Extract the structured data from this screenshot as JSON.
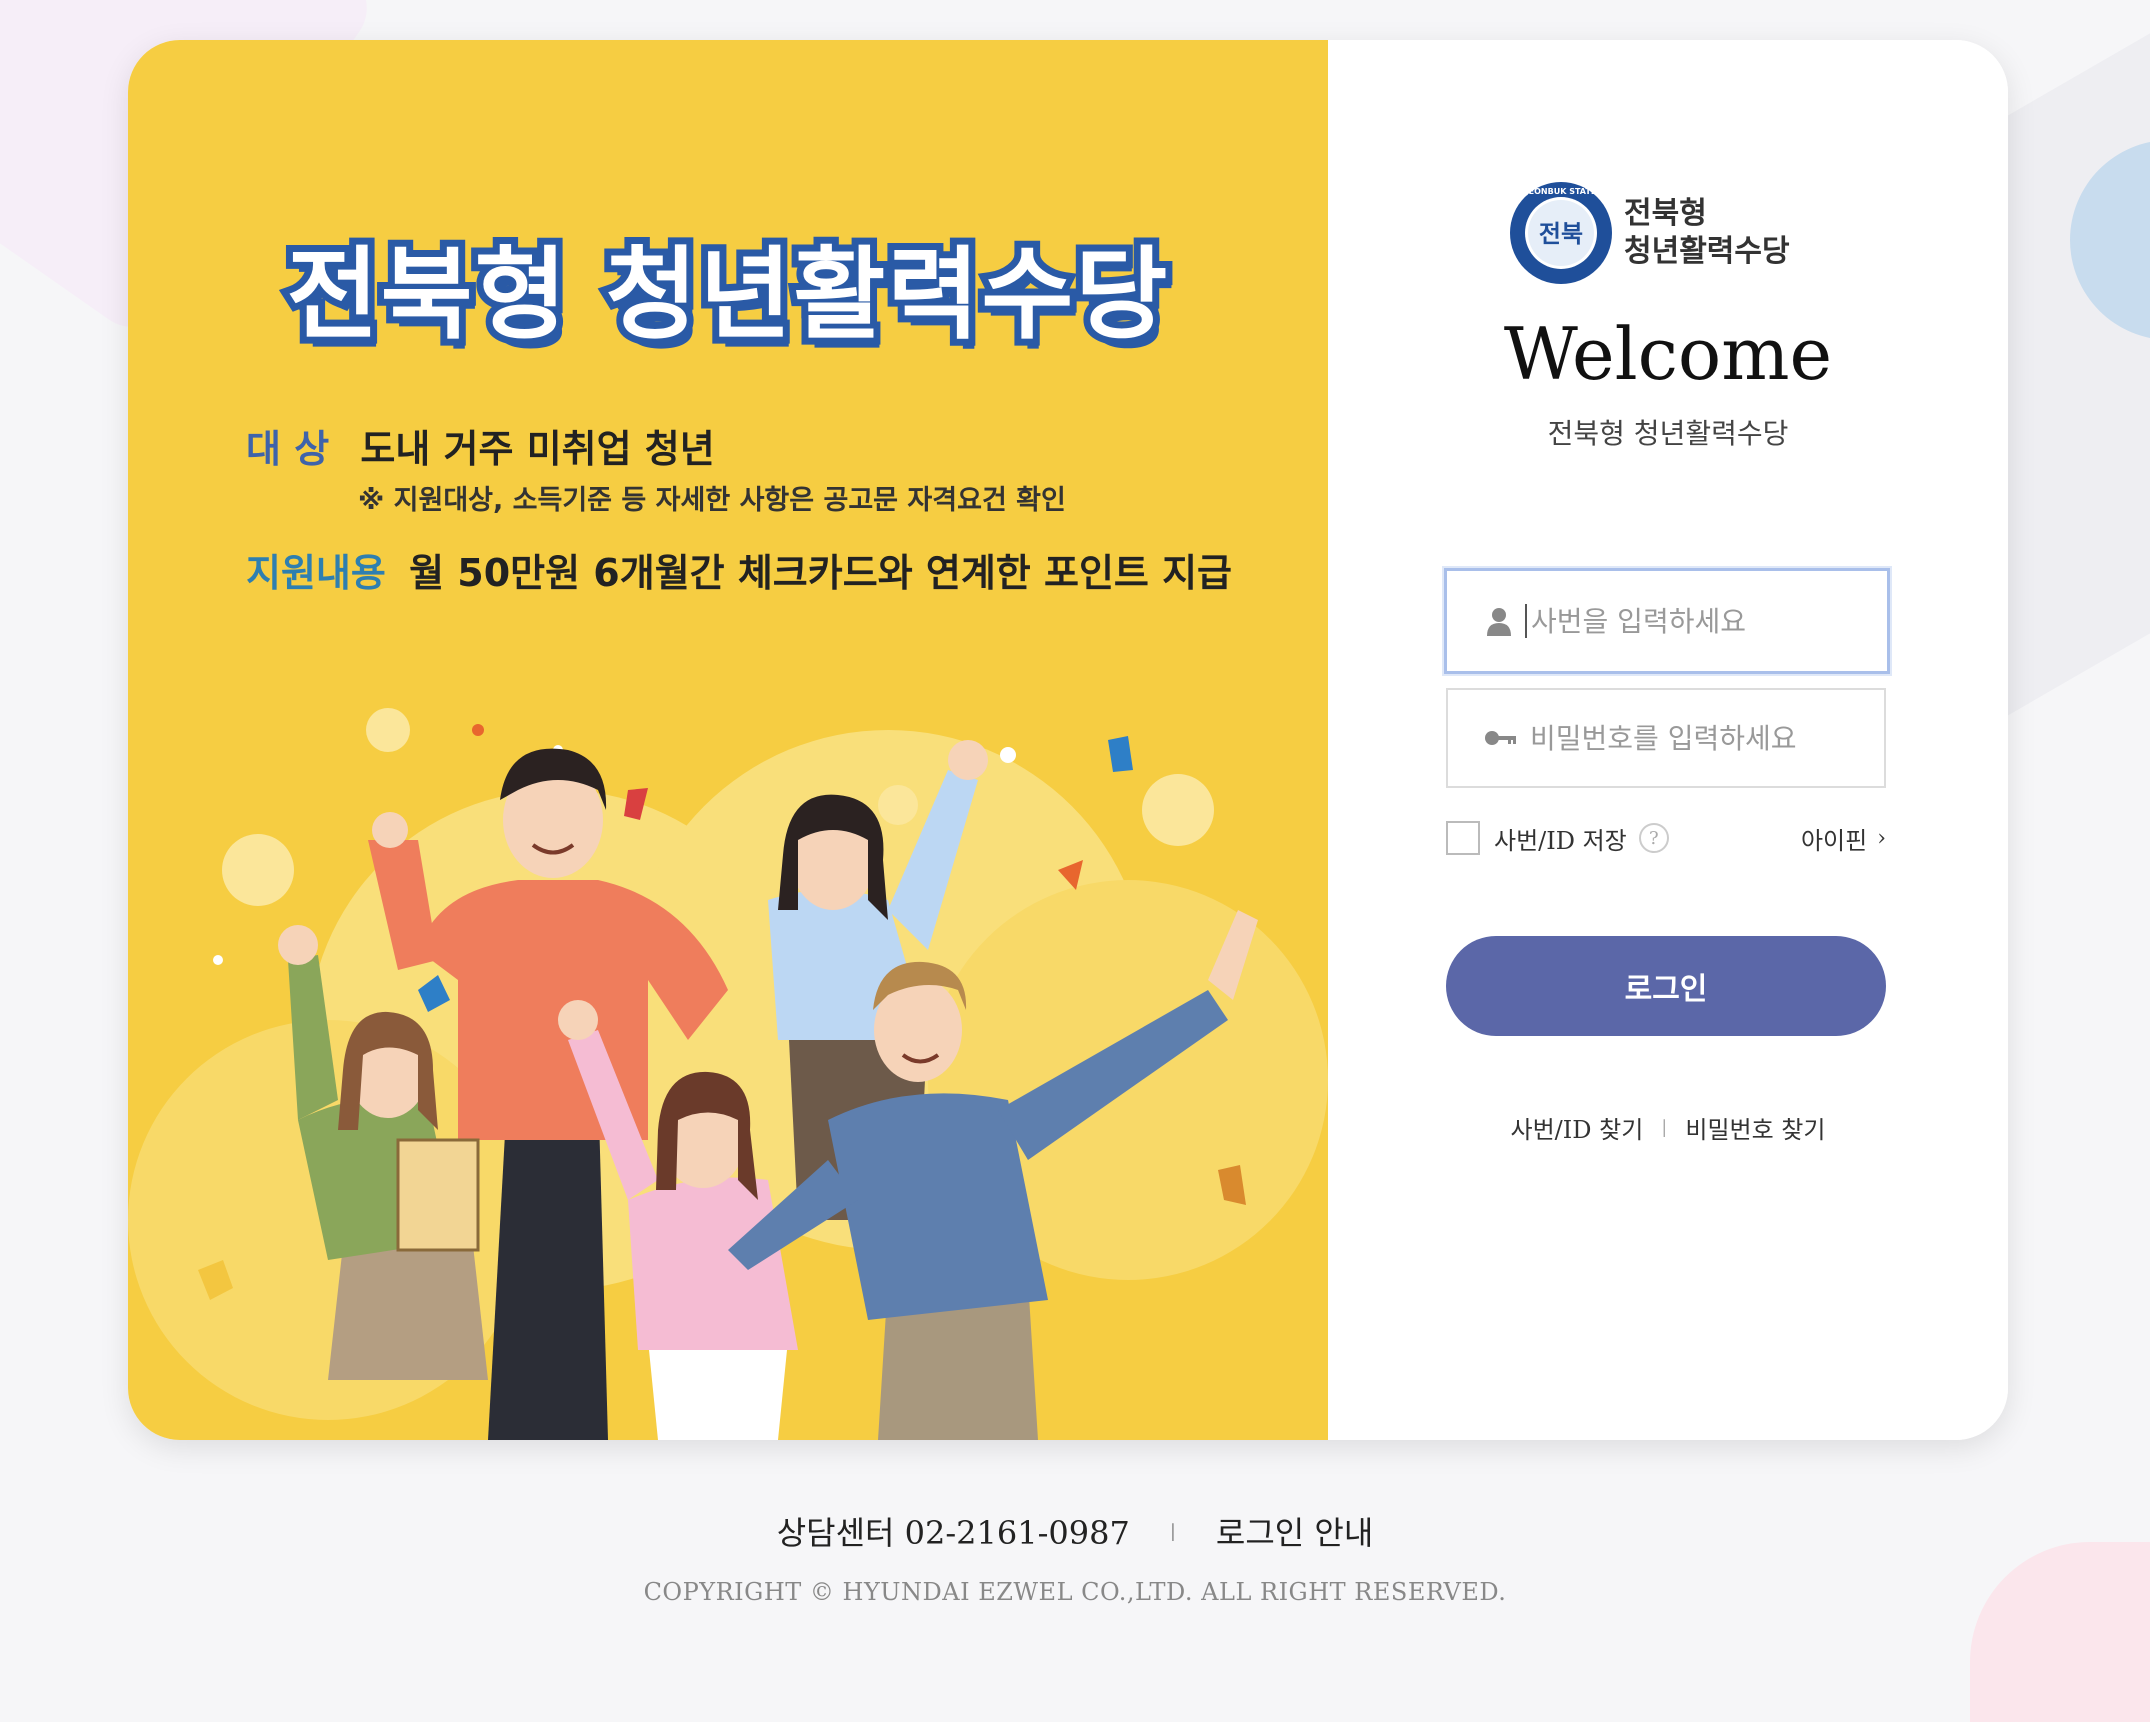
{
  "banner": {
    "title": "전북형 청년활력수당",
    "target_label": "대  상",
    "target_text": "도내 거주 미취업 청년",
    "note": "※ 지원대상, 소득기준 등 자세한 사항은 공고문 자격요건 확인",
    "support_label": "지원내용",
    "support_text": "월 50만원 6개월간 체크카드와 연계한 포인트 지급"
  },
  "logo": {
    "line1": "전북형",
    "line2": "청년활력수당",
    "badge_text": "전북",
    "ring_text": "JEONBUK STATE"
  },
  "login": {
    "welcome": "Welcome",
    "subtitle": "전북형 청년활력수당",
    "id_placeholder": "사번을 입력하세요",
    "pw_placeholder": "비밀번호를 입력하세요",
    "save_label": "사번/ID 저장",
    "help_symbol": "?",
    "ipin_label": "아이핀",
    "ipin_chevron": "›",
    "login_button": "로그인",
    "find_id": "사번/ID 찾기",
    "find_sep": "|",
    "find_pw": "비밀번호 찾기"
  },
  "footer": {
    "call_center": "상담센터 02-2161-0987",
    "sep": "|",
    "login_guide": "로그인 안내",
    "copyright": "COPYRIGHT © HYUNDAI EZWEL CO.,LTD. ALL RIGHT RESERVED."
  },
  "colors": {
    "banner_bg": "#f6cd42",
    "title_outline": "#2a5aa6",
    "login_button": "#5b67a8",
    "focused_border": "#a9bfea"
  },
  "icons": {
    "id_field": "user-icon",
    "pw_field": "key-icon"
  }
}
